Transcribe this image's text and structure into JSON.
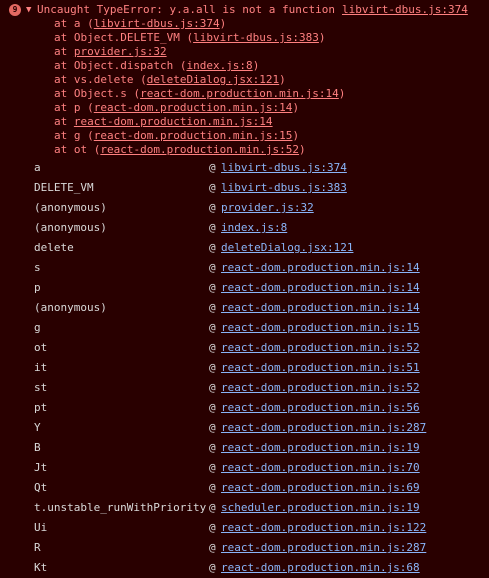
{
  "error": {
    "count": "9",
    "toggle": "▼",
    "message": "Uncaught TypeError: y.a.all is not a function",
    "source": "libvirt-dbus.js:374"
  },
  "stack_lines": [
    {
      "prefix": "at a (",
      "link": "libvirt-dbus.js:374",
      "suffix": ")"
    },
    {
      "prefix": "at Object.DELETE_VM (",
      "link": "libvirt-dbus.js:383",
      "suffix": ")"
    },
    {
      "prefix": "at ",
      "link": "provider.js:32",
      "suffix": ""
    },
    {
      "prefix": "at Object.dispatch (",
      "link": "index.js:8",
      "suffix": ")"
    },
    {
      "prefix": "at vs.delete (",
      "link": "deleteDialog.jsx:121",
      "suffix": ")"
    },
    {
      "prefix": "at Object.s (",
      "link": "react-dom.production.min.js:14",
      "suffix": ")"
    },
    {
      "prefix": "at p (",
      "link": "react-dom.production.min.js:14",
      "suffix": ")"
    },
    {
      "prefix": "at ",
      "link": "react-dom.production.min.js:14",
      "suffix": ""
    },
    {
      "prefix": "at g (",
      "link": "react-dom.production.min.js:15",
      "suffix": ")"
    },
    {
      "prefix": "at ot (",
      "link": "react-dom.production.min.js:52",
      "suffix": ")"
    }
  ],
  "at_symbol": "@",
  "frames": [
    {
      "fn": "a",
      "loc": "libvirt-dbus.js:374"
    },
    {
      "fn": "DELETE_VM",
      "loc": "libvirt-dbus.js:383"
    },
    {
      "fn": "(anonymous)",
      "loc": "provider.js:32"
    },
    {
      "fn": "(anonymous)",
      "loc": "index.js:8"
    },
    {
      "fn": "delete",
      "loc": "deleteDialog.jsx:121"
    },
    {
      "fn": "s",
      "loc": "react-dom.production.min.js:14"
    },
    {
      "fn": "p",
      "loc": "react-dom.production.min.js:14"
    },
    {
      "fn": "(anonymous)",
      "loc": "react-dom.production.min.js:14"
    },
    {
      "fn": "g",
      "loc": "react-dom.production.min.js:15"
    },
    {
      "fn": "ot",
      "loc": "react-dom.production.min.js:52"
    },
    {
      "fn": "it",
      "loc": "react-dom.production.min.js:51"
    },
    {
      "fn": "st",
      "loc": "react-dom.production.min.js:52"
    },
    {
      "fn": "pt",
      "loc": "react-dom.production.min.js:56"
    },
    {
      "fn": "Y",
      "loc": "react-dom.production.min.js:287"
    },
    {
      "fn": "B",
      "loc": "react-dom.production.min.js:19"
    },
    {
      "fn": "Jt",
      "loc": "react-dom.production.min.js:70"
    },
    {
      "fn": "Qt",
      "loc": "react-dom.production.min.js:69"
    },
    {
      "fn": "t.unstable_runWithPriority",
      "loc": "scheduler.production.min.js:19"
    },
    {
      "fn": "Ui",
      "loc": "react-dom.production.min.js:122"
    },
    {
      "fn": "R",
      "loc": "react-dom.production.min.js:287"
    },
    {
      "fn": "Kt",
      "loc": "react-dom.production.min.js:68"
    }
  ],
  "colors": {
    "background": "#290000",
    "error_text": "#ff8080",
    "badge": "#e46962",
    "link": "#8ab4f8",
    "frame_text": "#d9d9d9"
  }
}
